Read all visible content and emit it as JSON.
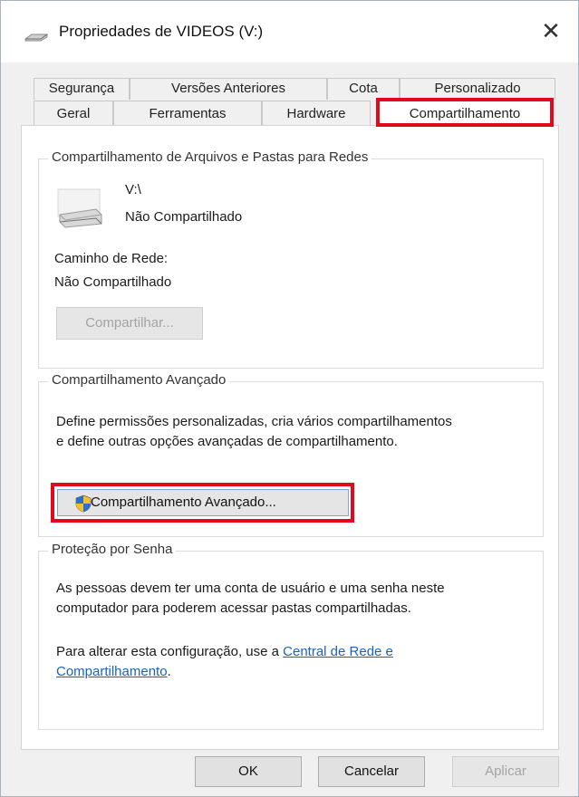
{
  "window": {
    "title": "Propriedades de VIDEOS (V:)",
    "close_label": "✕"
  },
  "tabs": {
    "row1": [
      "Segurança",
      "Versões Anteriores",
      "Cota",
      "Personalizado"
    ],
    "row2": [
      "Geral",
      "Ferramentas",
      "Hardware",
      "Compartilhamento"
    ],
    "active": "Compartilhamento"
  },
  "network_sharing": {
    "title": "Compartilhamento de Arquivos e Pastas para Redes",
    "drive_path": "V:\\",
    "drive_status": "Não Compartilhado",
    "network_path_label": "Caminho de Rede:",
    "network_path_value": "Não Compartilhado",
    "share_button": "Compartilhar..."
  },
  "advanced_sharing": {
    "title": "Compartilhamento Avançado",
    "description_line1": "Define permissões personalizadas, cria vários compartilhamentos",
    "description_line2": "e define outras opções avançadas de compartilhamento.",
    "button_label": "Compartilhamento Avançado..."
  },
  "password_protection": {
    "title": "Proteção por Senha",
    "description_line1": "As pessoas devem ter uma conta de usuário e uma senha neste",
    "description_line2": "computador para poderem acessar pastas compartilhadas.",
    "change_text": "Para alterar esta configuração, use a ",
    "link_part1": "Central de Rede e",
    "link_part2": "Compartilhamento",
    "period": "."
  },
  "footer": {
    "ok": "OK",
    "cancel": "Cancelar",
    "apply": "Aplicar"
  },
  "colors": {
    "highlight": "#e3091d",
    "link": "#1565c0"
  }
}
